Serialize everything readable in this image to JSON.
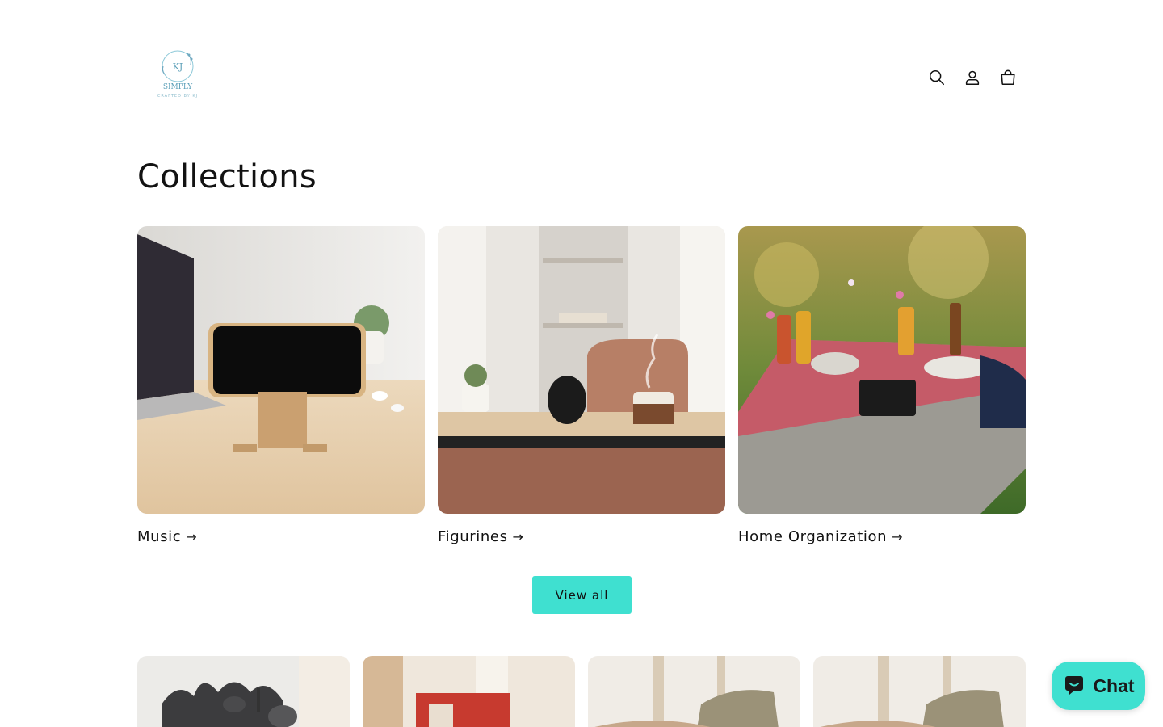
{
  "header": {
    "logo": {
      "monogram": "KJ",
      "name": "SIMPLY",
      "tagline": "CRAFTED BY KJ"
    },
    "icons": [
      "search-icon",
      "account-icon",
      "cart-icon"
    ]
  },
  "page_title": "Collections",
  "collections": [
    {
      "title": "Music",
      "arrow": "→"
    },
    {
      "title": "Figurines",
      "arrow": "→"
    },
    {
      "title": "Home Organization",
      "arrow": "→"
    }
  ],
  "view_all_label": "View all",
  "chat": {
    "label": "Chat",
    "icon": "chat-bubble-icon"
  },
  "colors": {
    "accent": "#3fe0d0",
    "text": "#121212"
  }
}
